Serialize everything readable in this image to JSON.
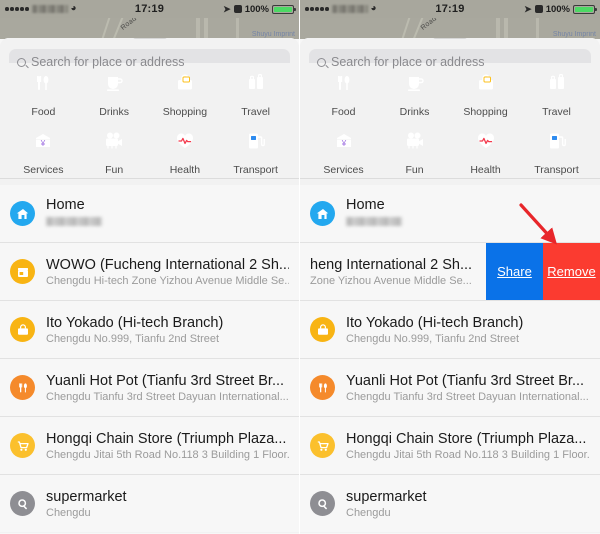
{
  "statusbar": {
    "carrier": "",
    "wifi_icon": "wifi-icon",
    "time": "17:19",
    "location_icon": "location-arrow-icon",
    "lock_icon": "rotation-lock-icon",
    "battery_percent": "100%"
  },
  "map": {
    "label": "Road",
    "attribution": "Shuyu Imprint"
  },
  "search": {
    "placeholder": "Search for place or address",
    "value": "",
    "icon": "search-icon"
  },
  "categories": [
    {
      "label": "Food",
      "icon": "fork-knife-icon",
      "color": "#F5862B"
    },
    {
      "label": "Drinks",
      "icon": "cup-icon",
      "color": "#F5862B"
    },
    {
      "label": "Shopping",
      "icon": "shopping-bag-icon",
      "color": "#FCC01C"
    },
    {
      "label": "Travel",
      "icon": "luggage-icon",
      "color": "#2BBB3E"
    },
    {
      "label": "Services",
      "icon": "bank-yen-icon",
      "color": "#9B6BE0"
    },
    {
      "label": "Fun",
      "icon": "movie-camera-icon",
      "color": "#F555C0"
    },
    {
      "label": "Health",
      "icon": "heart-pulse-icon",
      "color": "#F43B4E"
    },
    {
      "label": "Transport",
      "icon": "gas-pump-icon",
      "color": "#2E8BEF"
    }
  ],
  "left_panel": {
    "rows": [
      {
        "title": "Home",
        "subtitle": "",
        "subtitle_blurred": true,
        "icon": "home-icon",
        "color": "#23A8EF"
      },
      {
        "title": "WOWO (Fucheng International 2 Sh...",
        "subtitle": "Chengdu Hi-tech Zone Yizhou Avenue Middle Se...",
        "subtitle_blurred": false,
        "icon": "store-icon",
        "color": "#F8B413"
      },
      {
        "title": "Ito Yokado (Hi-tech Branch)",
        "subtitle": "Chengdu No.999, Tianfu 2nd Street",
        "subtitle_blurred": false,
        "icon": "shopping-bag-icon",
        "color": "#F8B413"
      },
      {
        "title": "Yuanli Hot Pot (Tianfu 3rd Street Br...",
        "subtitle": "Chengdu Tianfu 3rd Street Dayuan International...",
        "subtitle_blurred": false,
        "icon": "fork-knife-icon",
        "color": "#F58A2B"
      },
      {
        "title": "Hongqi Chain Store (Triumph Plaza...",
        "subtitle": "Chengdu Jitai 5th Road No.118 3 Building 1 Floor...",
        "subtitle_blurred": false,
        "icon": "shopping-cart-icon",
        "color": "#FBC02D"
      },
      {
        "title": "supermarket",
        "subtitle": "Chengdu",
        "subtitle_blurred": false,
        "icon": "search-icon",
        "color": "#8E8E93"
      }
    ]
  },
  "right_panel": {
    "rows": [
      {
        "title": "Home",
        "subtitle": "",
        "subtitle_blurred": true,
        "icon": "home-icon",
        "color": "#23A8EF"
      },
      {
        "title": "heng International 2 Sh...",
        "subtitle": "Zone Yizhou Avenue Middle Se...",
        "subtitle_blurred": false,
        "icon": "store-icon",
        "color": "#F8B413",
        "swiped": true
      },
      {
        "title": "Ito Yokado (Hi-tech Branch)",
        "subtitle": "Chengdu No.999, Tianfu 2nd Street",
        "subtitle_blurred": false,
        "icon": "shopping-bag-icon",
        "color": "#F8B413"
      },
      {
        "title": "Yuanli Hot Pot (Tianfu 3rd Street Br...",
        "subtitle": "Chengdu Tianfu 3rd Street Dayuan International...",
        "subtitle_blurred": false,
        "icon": "fork-knife-icon",
        "color": "#F58A2B"
      },
      {
        "title": "Hongqi Chain Store (Triumph Plaza...",
        "subtitle": "Chengdu Jitai 5th Road No.118 3 Building 1 Floor...",
        "subtitle_blurred": false,
        "icon": "shopping-cart-icon",
        "color": "#FBC02D"
      },
      {
        "title": "supermarket",
        "subtitle": "Chengdu",
        "subtitle_blurred": false,
        "icon": "search-icon",
        "color": "#8E8E93"
      }
    ],
    "swipe_actions": {
      "share_label": "Share",
      "share_color": "#0A72E8",
      "remove_label": "Remove",
      "remove_color": "#FB3B30"
    }
  },
  "annotation": {
    "arrow_color": "#E8262A",
    "arrow_name": "red-pointer-arrow"
  }
}
